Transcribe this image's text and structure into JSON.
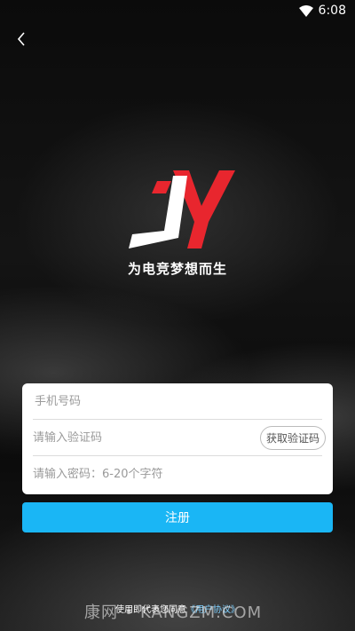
{
  "status_bar": {
    "time": "6:08"
  },
  "slogan": "为电竞梦想而生",
  "form": {
    "phone_placeholder": "手机号码",
    "code_placeholder": "请输入验证码",
    "get_code_label": "获取验证码",
    "password_placeholder": "请输入密码：6-20个字符"
  },
  "register_label": "注册",
  "footer": {
    "prefix": "使用即代表您同意",
    "agreement": "《用户协议》"
  },
  "watermark": "康网 • KANGZM.COM",
  "colors": {
    "accent": "#1ab6f5",
    "logo_red": "#e8262e"
  }
}
